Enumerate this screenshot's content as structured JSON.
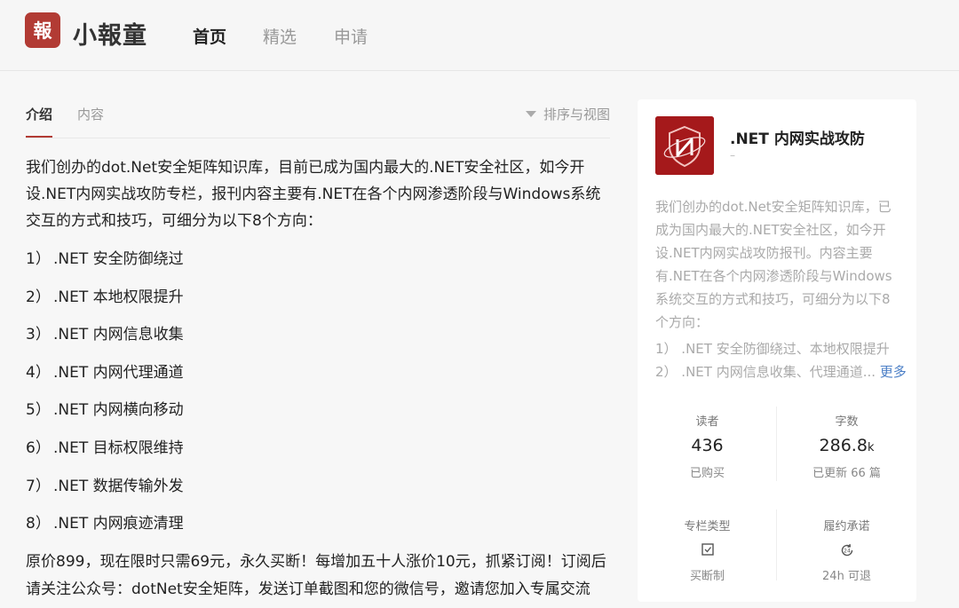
{
  "header": {
    "logo_char": "報",
    "brand": "小報童",
    "nav": [
      "首页",
      "精选",
      "申请"
    ]
  },
  "tabs": {
    "items": [
      "介绍",
      "内容"
    ],
    "sort_label": "排序与视图"
  },
  "intro": "我们创办的dot.Net安全矩阵知识库，目前已成为国内最大的.NET安全社区，如今开设.NET内网实战攻防专栏，报刊内容主要有.NET在各个内网渗透阶段与Windows系统交互的方式和技巧，可细分为以下8个方向：",
  "directions": [
    {
      "num": "1）",
      "text": ".NET 安全防御绕过"
    },
    {
      "num": "2）",
      "text": ".NET 本地权限提升"
    },
    {
      "num": "3）",
      "text": ".NET 内网信息收集"
    },
    {
      "num": "4）",
      "text": ".NET 内网代理通道"
    },
    {
      "num": "5）",
      "text": ".NET 内网横向移动"
    },
    {
      "num": "6）",
      "text": ".NET 目标权限维持"
    },
    {
      "num": "7）",
      "text": ".NET 数据传输外发"
    },
    {
      "num": "8）",
      "text": ".NET 内网痕迹清理"
    }
  ],
  "price_note": "原价899，现在限时只需69元，永久买断！每增加五十人涨价10元，抓紧订阅！订阅后请关注公众号：dotNet安全矩阵，发送订单截图和您的微信号，邀请您加入专属交流群。",
  "card": {
    "title": ".NET 内网实战攻防",
    "subtitle": "–",
    "desc": "我们创办的dot.Net安全矩阵知识库，已成为国内最大的.NET安全社区，如今开设.NET内网实战攻防报刊。内容主要有.NET在各个内网渗透阶段与Windows系统交互的方式和技巧，可细分为以下8个方向：",
    "point1": "1）   .NET 安全防御绕过、本地权限提升",
    "point2": "2）   .NET 内网信息收集、代理通道...",
    "more": "更多",
    "stats": {
      "readers_label": "读者",
      "readers_value": "436",
      "readers_sub": "已购买",
      "words_label": "字数",
      "words_value": "286.8",
      "words_unit": "k",
      "words_sub": "已更新 66 篇",
      "type_label": "专栏类型",
      "type_sub": "买断制",
      "promise_label": "履约承诺",
      "promise_sub": "24h 可退"
    }
  },
  "colors": {
    "brand_red": "#b23b34",
    "link_blue": "#4a7ec6",
    "cover_red": "#a5191b"
  },
  "icons": [
    "check-box-icon",
    "24h-refresh-icon",
    "shield-logo-icon",
    "dropdown-triangle-icon"
  ]
}
